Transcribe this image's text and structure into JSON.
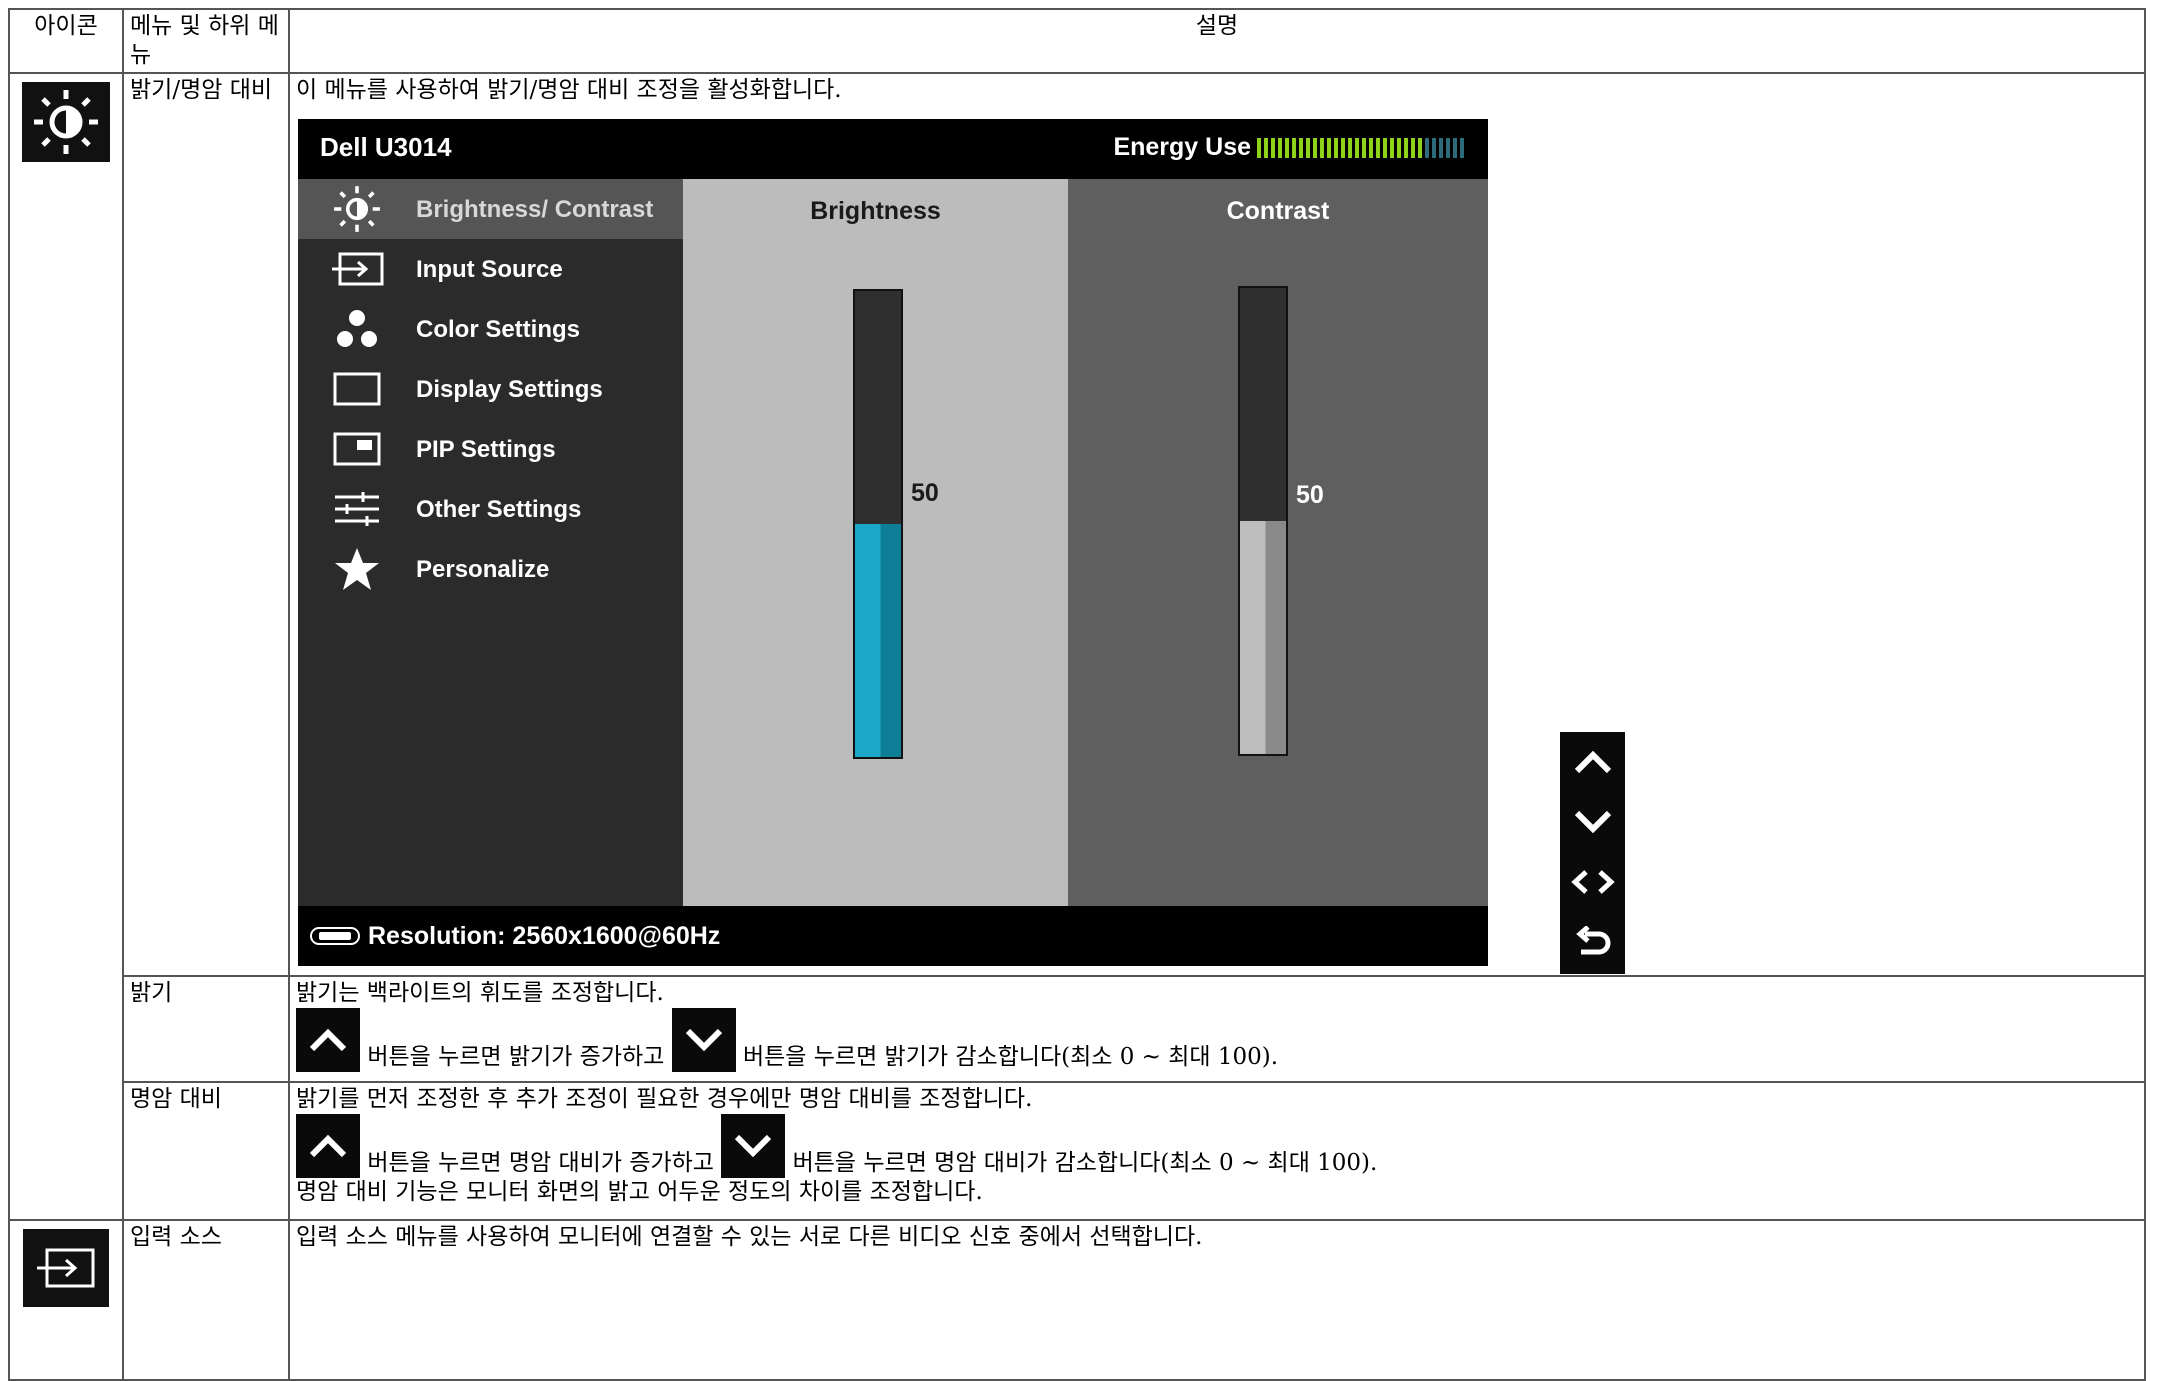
{
  "table": {
    "headers": {
      "icon": "아이콘",
      "menu": "메뉴 및 하위 메뉴",
      "desc": "설명"
    },
    "rows": {
      "brightness_contrast": {
        "menu": "밝기/명암 대비",
        "desc": "이 메뉴를 사용하여 밝기/명암 대비 조정을 활성화합니다.",
        "icon": "brightness-contrast-icon"
      },
      "brightness": {
        "menu": "밝기",
        "line1": "밝기는 백라이트의 휘도를 조정합니다.",
        "line2a": "버튼을 누르면 밝기가 증가하고",
        "line2b": "버튼을 누르면 밝기가 감소합니다(최소 0 ~ 최대 100)."
      },
      "contrast": {
        "menu": "명암 대비",
        "line1": "밝기를 먼저 조정한 후 추가 조정이 필요한 경우에만 명암 대비를 조정합니다.",
        "line2a": "버튼을 누르면 명암 대비가 증가하고",
        "line2b": "버튼을 누르면 명암 대비가 감소합니다(최소 0 ~ 최대 100).",
        "line3": "명암 대비 기능은 모니터 화면의 밝고 어두운 정도의 차이를 조정합니다."
      },
      "input_source": {
        "menu": "입력 소스",
        "desc": "입력 소스 메뉴를 사용하여 모니터에 연결할 수 있는 서로 다른 비디오 신호 중에서 선택합니다.",
        "icon": "input-source-icon"
      }
    }
  },
  "osd": {
    "model": "Dell U3014",
    "energy_label": "Energy Use",
    "energy_level": 0.8,
    "menu": [
      {
        "label": "Brightness/ Contrast",
        "icon": "brightness-contrast-icon",
        "active": true
      },
      {
        "label": "Input Source",
        "icon": "input-source-icon"
      },
      {
        "label": "Color Settings",
        "icon": "color-settings-icon"
      },
      {
        "label": "Display Settings",
        "icon": "display-settings-icon"
      },
      {
        "label": "PIP Settings",
        "icon": "pip-settings-icon"
      },
      {
        "label": "Other Settings",
        "icon": "other-settings-icon"
      },
      {
        "label": "Personalize",
        "icon": "star-icon"
      }
    ],
    "brightness": {
      "title": "Brightness",
      "value": "50",
      "level": 0.5,
      "color": "#1ba7c7"
    },
    "contrast": {
      "title": "Contrast",
      "value": "50",
      "level": 0.5,
      "color": "#bdbdbd"
    },
    "footer": "Resolution: 2560x1600@60Hz",
    "nav_buttons": [
      "up-arrow-icon",
      "down-arrow-icon",
      "left-right-arrow-icon",
      "back-icon"
    ]
  },
  "colors": {
    "energy_green": "#8ed31a",
    "energy_off": "#2d6b7a",
    "brightness_fill": "#1ba7c7"
  }
}
